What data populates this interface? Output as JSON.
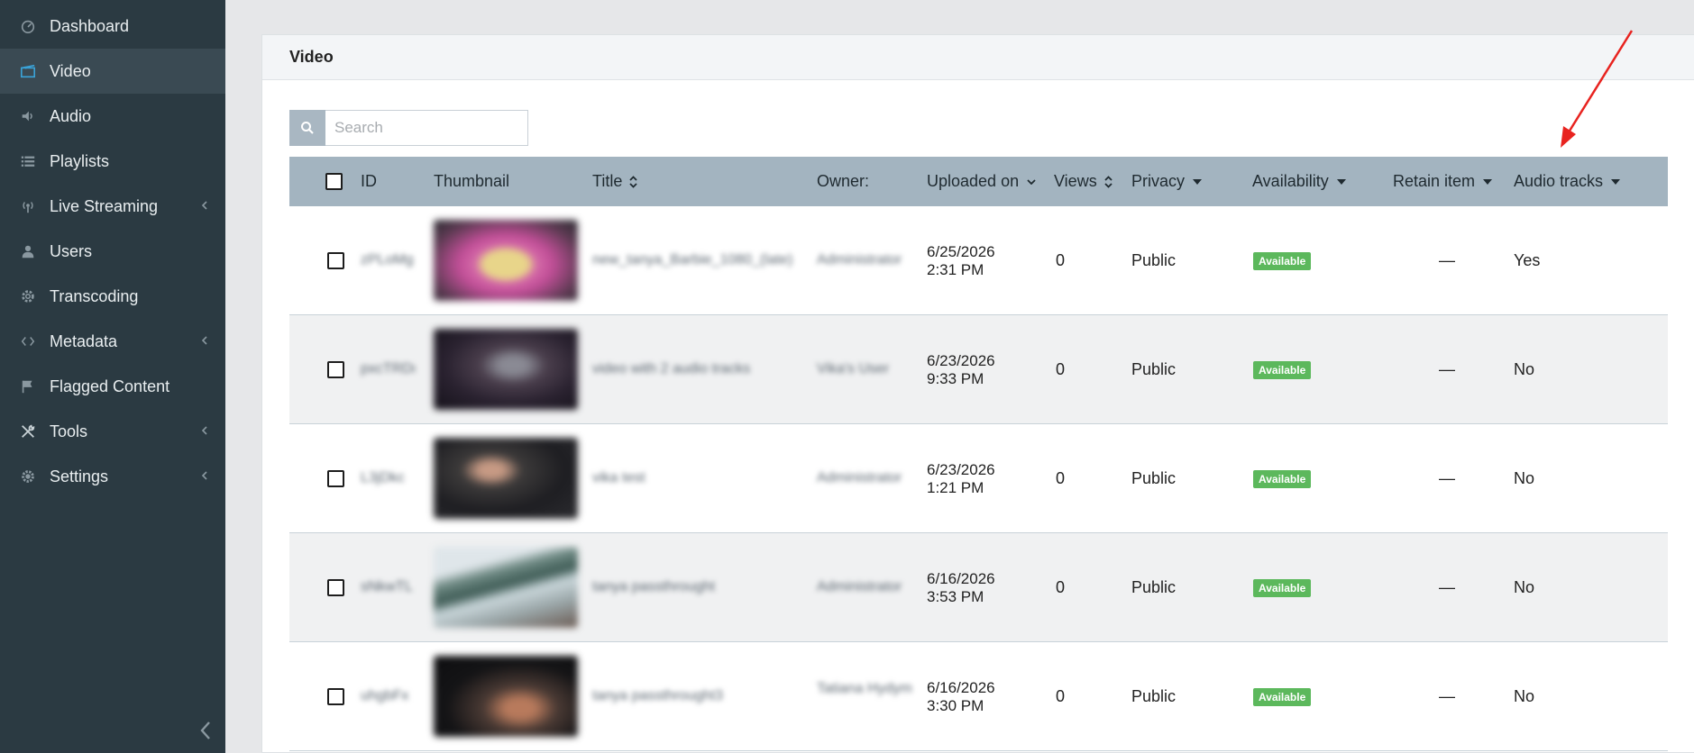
{
  "sidebar": {
    "items": [
      {
        "label": "Dashboard",
        "icon": "dashboard-icon"
      },
      {
        "label": "Video",
        "icon": "clapperboard-icon",
        "active": true
      },
      {
        "label": "Audio",
        "icon": "speaker-icon"
      },
      {
        "label": "Playlists",
        "icon": "list-icon"
      },
      {
        "label": "Live Streaming",
        "icon": "broadcast-icon",
        "expandable": true
      },
      {
        "label": "Users",
        "icon": "user-icon"
      },
      {
        "label": "Transcoding",
        "icon": "cog-icon"
      },
      {
        "label": "Metadata",
        "icon": "code-icon",
        "expandable": true
      },
      {
        "label": "Flagged Content",
        "icon": "flag-icon"
      },
      {
        "label": "Tools",
        "icon": "wrench-icon",
        "expandable": true
      },
      {
        "label": "Settings",
        "icon": "gear-icon",
        "expandable": true
      }
    ]
  },
  "panel": {
    "title": "Video"
  },
  "search": {
    "placeholder": "Search"
  },
  "table": {
    "columns": {
      "id": "ID",
      "thumbnail": "Thumbnail",
      "title": "Title",
      "owner": "Owner:",
      "uploaded": "Uploaded on",
      "views": "Views",
      "privacy": "Privacy",
      "availability": "Availability",
      "retain": "Retain item",
      "audio_tracks": "Audio tracks"
    },
    "rows": [
      {
        "id": "zPLoMg",
        "title": "new_tanya_Barbie_1080_(late)",
        "owner": "Administrator",
        "date": "6/25/2026",
        "time": "2:31 PM",
        "views": "0",
        "privacy": "Public",
        "availability": "Available",
        "retain": "—",
        "audio_tracks": "Yes"
      },
      {
        "id": "pxcTRDn",
        "title": "video with 2 audio tracks",
        "owner": "Vika's User",
        "date": "6/23/2026",
        "time": "9:33 PM",
        "views": "0",
        "privacy": "Public",
        "availability": "Available",
        "retain": "—",
        "audio_tracks": "No"
      },
      {
        "id": "L3jDkc",
        "title": "vika test",
        "owner": "Administrator",
        "date": "6/23/2026",
        "time": "1:21 PM",
        "views": "0",
        "privacy": "Public",
        "availability": "Available",
        "retain": "—",
        "audio_tracks": "No"
      },
      {
        "id": "sNkwTL",
        "title": "tanya passthrought",
        "owner": "Administrator",
        "date": "6/16/2026",
        "time": "3:53 PM",
        "views": "0",
        "privacy": "Public",
        "availability": "Available",
        "retain": "—",
        "audio_tracks": "No"
      },
      {
        "id": "uhgbFx",
        "title": "tanya passthrought3",
        "owner": "Tatiana Hydym",
        "date": "6/16/2026",
        "time": "3:30 PM",
        "views": "0",
        "privacy": "Public",
        "availability": "Available",
        "retain": "—",
        "audio_tracks": "No"
      }
    ]
  },
  "colors": {
    "sidebar_bg": "#2b3a42",
    "accent": "#3aa3d8",
    "table_header_bg": "#a3b4c0",
    "badge_green": "#5cb85c",
    "annotation_arrow": "#e8231f"
  }
}
